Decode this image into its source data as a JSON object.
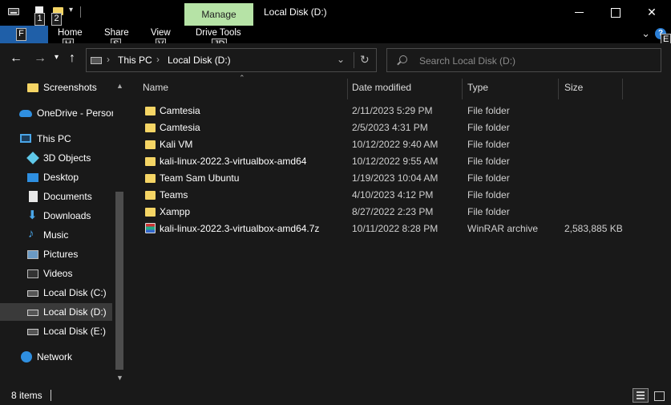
{
  "titlebar": {
    "manage_tab": "Manage",
    "window_title": "Local Disk (D:)",
    "keytips": {
      "k1": "1",
      "k2": "2"
    },
    "close_glyph": "✕"
  },
  "ribbon": {
    "tabs": [
      {
        "label": "Home",
        "keytip": "H"
      },
      {
        "label": "Share",
        "keytip": "S"
      },
      {
        "label": "View",
        "keytip": "V"
      },
      {
        "label": "Drive Tools",
        "keytip": "JD"
      }
    ],
    "file_keytip": "F",
    "help_keytip": "E",
    "help_glyph": "?"
  },
  "address": {
    "crumbs": [
      "This PC",
      "Local Disk (D:)"
    ],
    "search_placeholder": "Search Local Disk (D:)"
  },
  "sidebar": {
    "items": [
      {
        "label": "Screenshots",
        "icon": "folder-icon"
      },
      {
        "label": "OneDrive - Persor",
        "icon": "cloud-icon"
      },
      {
        "label": "This PC",
        "icon": "computer-icon"
      },
      {
        "label": "3D Objects",
        "icon": "cube-icon"
      },
      {
        "label": "Desktop",
        "icon": "desktop-icon"
      },
      {
        "label": "Documents",
        "icon": "document-icon"
      },
      {
        "label": "Downloads",
        "icon": "download-icon"
      },
      {
        "label": "Music",
        "icon": "music-icon"
      },
      {
        "label": "Pictures",
        "icon": "pictures-icon"
      },
      {
        "label": "Videos",
        "icon": "videos-icon"
      },
      {
        "label": "Local Disk (C:)",
        "icon": "drive-icon"
      },
      {
        "label": "Local Disk (D:)",
        "icon": "drive-icon",
        "selected": true
      },
      {
        "label": "Local Disk (E:)",
        "icon": "drive-icon"
      },
      {
        "label": "Network",
        "icon": "network-icon"
      }
    ]
  },
  "columns": {
    "name": "Name",
    "date": "Date modified",
    "type": "Type",
    "size": "Size"
  },
  "files": [
    {
      "name": "Camtesia",
      "date": "2/11/2023 5:29 PM",
      "type": "File folder",
      "size": "",
      "icon": "folder-icon"
    },
    {
      "name": "Camtesia",
      "date": "2/5/2023 4:31 PM",
      "type": "File folder",
      "size": "",
      "icon": "folder-icon"
    },
    {
      "name": "Kali VM",
      "date": "10/12/2022 9:40 AM",
      "type": "File folder",
      "size": "",
      "icon": "folder-icon"
    },
    {
      "name": "kali-linux-2022.3-virtualbox-amd64",
      "date": "10/12/2022 9:55 AM",
      "type": "File folder",
      "size": "",
      "icon": "folder-icon"
    },
    {
      "name": "Team Sam Ubuntu",
      "date": "1/19/2023 10:04 AM",
      "type": "File folder",
      "size": "",
      "icon": "folder-icon"
    },
    {
      "name": "Teams",
      "date": "4/10/2023 4:12 PM",
      "type": "File folder",
      "size": "",
      "icon": "folder-icon"
    },
    {
      "name": "Xampp",
      "date": "8/27/2022 2:23 PM",
      "type": "File folder",
      "size": "",
      "icon": "folder-icon"
    },
    {
      "name": "kali-linux-2022.3-virtualbox-amd64.7z",
      "date": "10/11/2022 8:28 PM",
      "type": "WinRAR archive",
      "size": "2,583,885 KB",
      "icon": "archive-icon"
    }
  ],
  "status": {
    "item_count": "8 items"
  },
  "colors": {
    "background": "#191919",
    "manage_tab": "#b6e3a6",
    "file_tab": "#1f5fa8",
    "folder": "#f5d565",
    "selected": "#3a3a3a"
  }
}
